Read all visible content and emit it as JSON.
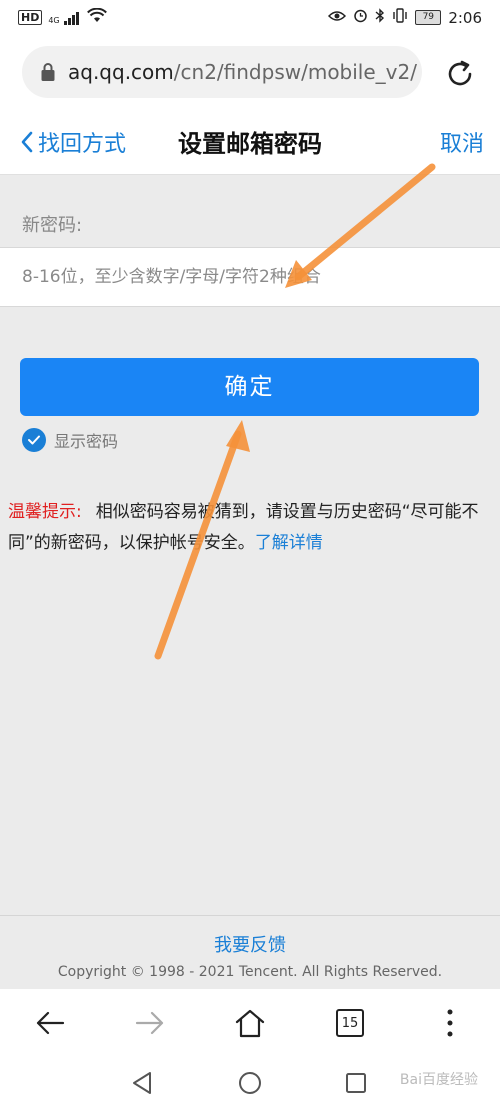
{
  "status_bar": {
    "network": "HD",
    "signal": "4G",
    "battery": "79",
    "time": "2:06"
  },
  "address_bar": {
    "domain": "aq.qq.com",
    "path": "/cn2/findpsw/mobile_v2/"
  },
  "header": {
    "back_label": "找回方式",
    "title": "设置邮箱密码",
    "cancel_label": "取消"
  },
  "form": {
    "password_label": "新密码:",
    "password_placeholder": "8-16位，至少含数字/字母/字符2种组合",
    "confirm_label": "确定",
    "show_password_label": "显示密码",
    "show_password_checked": true
  },
  "tip": {
    "label": "温馨提示:",
    "text": "相似密码容易被猜到，请设置与历史密码“尽可能不同”的新密码，以保护帐号安全。",
    "link": "了解详情"
  },
  "footer": {
    "feedback": "我要反馈",
    "copyright": "Copyright © 1998 - 2021 Tencent. All Rights Reserved."
  },
  "browser_toolbar": {
    "tab_count": "15"
  },
  "watermark": "Bai百度经验",
  "colors": {
    "accent": "#1a85f5",
    "link": "#1a7fd6",
    "warning": "#e02020",
    "annotation_arrow": "#f5913a",
    "page_bg": "#ebebeb"
  }
}
